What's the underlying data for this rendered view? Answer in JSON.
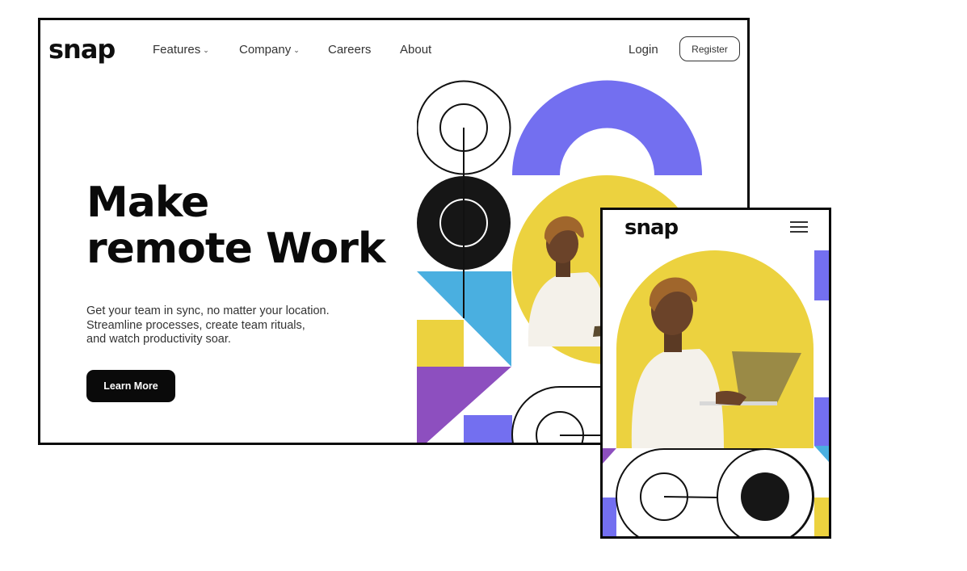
{
  "desktop": {
    "logo": "snap",
    "nav": {
      "features": "Features",
      "company": "Company",
      "careers": "Careers",
      "about": "About",
      "login": "Login",
      "register": "Register"
    },
    "hero": {
      "headline_line1": "Make",
      "headline_line2": "remote Work",
      "subtext_line1": "Get your team in sync, no matter your location.",
      "subtext_line2": "Streamline processes, create team rituals,",
      "subtext_line3": "and watch productivity soar.",
      "cta": "Learn More"
    }
  },
  "mobile": {
    "logo": "snap",
    "menu_icon": "hamburger-menu-icon"
  },
  "icons": {
    "dropdown": "chevron-down-icon"
  },
  "colors": {
    "violet": "#736ff0",
    "yellow": "#ecd23f",
    "sky": "#4aafe0",
    "purple": "#8d4fbf",
    "ink": "#121212"
  }
}
